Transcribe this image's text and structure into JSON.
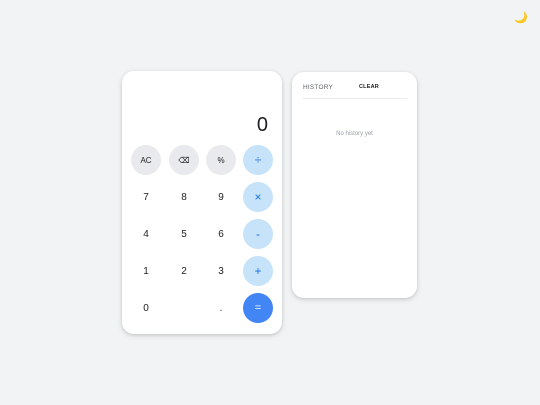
{
  "theme_toggle": {
    "icon": "moon-icon",
    "glyph": "🌙"
  },
  "calculator": {
    "display_value": "0",
    "keys": {
      "ac": "AC",
      "backspace": "⌫",
      "percent": "%",
      "divide": "÷",
      "seven": "7",
      "eight": "8",
      "nine": "9",
      "multiply": "×",
      "four": "4",
      "five": "5",
      "six": "6",
      "subtract": "-",
      "one": "1",
      "two": "2",
      "three": "3",
      "add": "+",
      "zero": "0",
      "decimal": ".",
      "equals": "="
    }
  },
  "history": {
    "title": "HISTORY",
    "clear_label": "CLEAR",
    "empty_message": "No history yet"
  },
  "colors": {
    "background": "#f1f3f4",
    "operator_bg": "#c6e3fa",
    "operator_text": "#1a73e8",
    "equals_bg": "#4285f4",
    "function_bg": "#e8eaed"
  }
}
